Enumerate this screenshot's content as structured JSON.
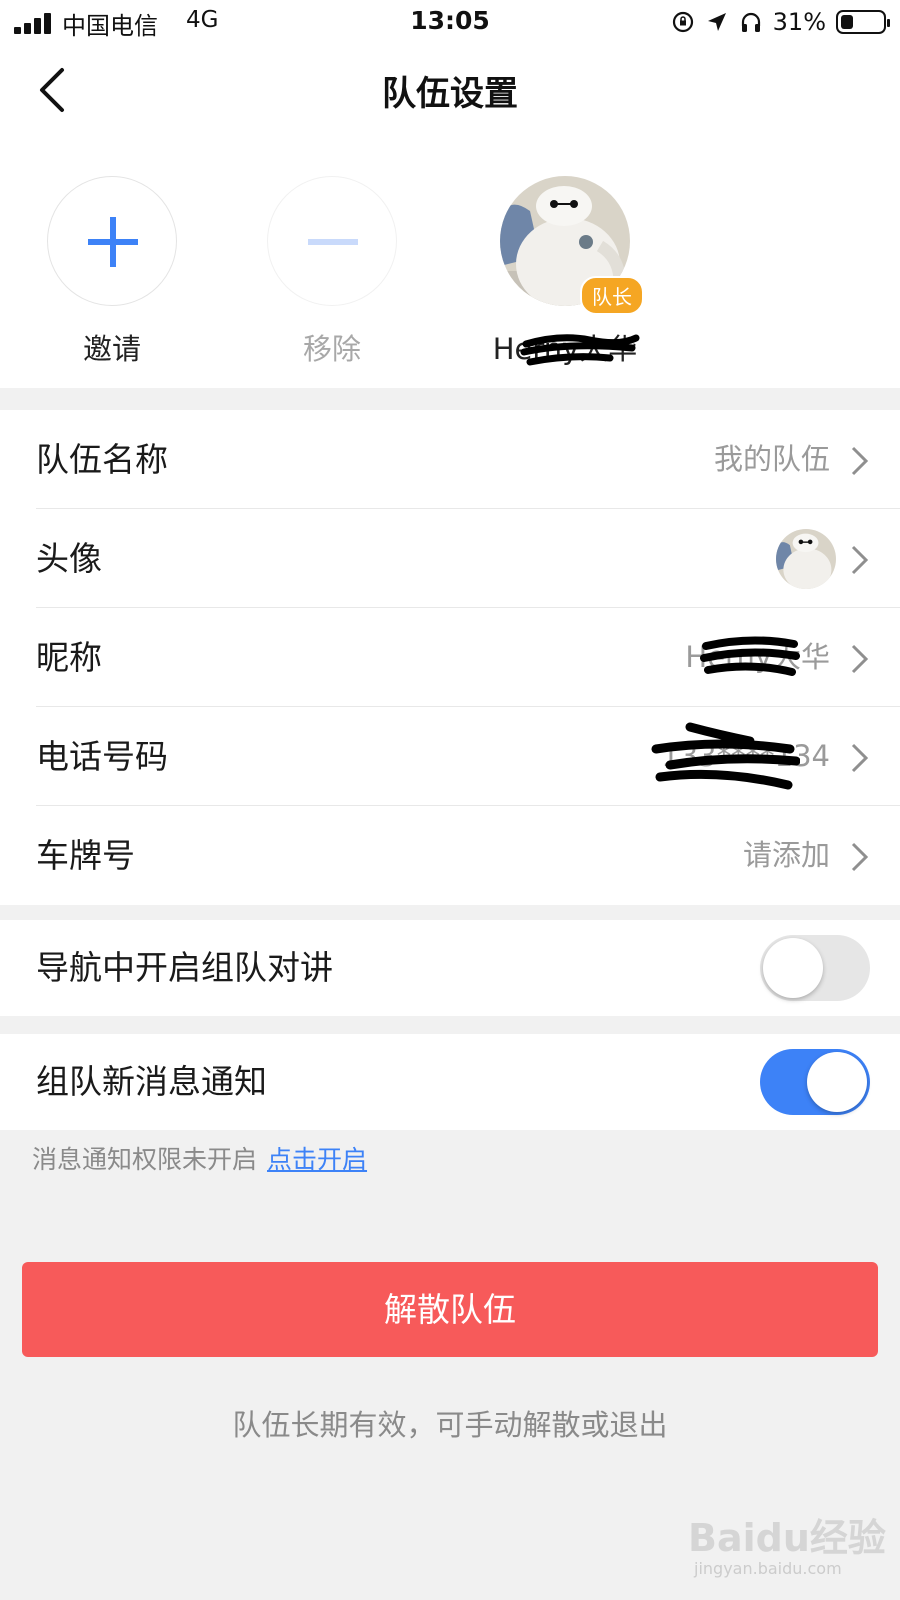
{
  "status_bar": {
    "carrier": "中国电信",
    "network": "4G",
    "time": "13:05",
    "battery_percent": "31%",
    "battery_level": 0.31,
    "icons": [
      "signal-icon",
      "orientation-lock-icon",
      "location-icon",
      "headphones-icon",
      "battery-icon"
    ]
  },
  "nav": {
    "title": "队伍设置",
    "back_icon": "chevron-left-icon"
  },
  "members": {
    "invite_label": "邀请",
    "remove_label": "移除",
    "leader_name": "Herny大华",
    "leader_badge": "队长",
    "accent_color": "#3d82f7"
  },
  "settings": {
    "team_name": {
      "label": "队伍名称",
      "value": "我的队伍"
    },
    "avatar": {
      "label": "头像"
    },
    "nickname": {
      "label": "昵称",
      "value": "Herny大华"
    },
    "phone": {
      "label": "电话号码",
      "value": "133****134"
    },
    "plate": {
      "label": "车牌号",
      "value": "请添加"
    }
  },
  "toggles": {
    "intercom": {
      "label": "导航中开启组队对讲",
      "on": false
    },
    "notify": {
      "label": "组队新消息通知",
      "on": true
    }
  },
  "notice": {
    "text": "消息通知权限未开启",
    "link": "点击开启"
  },
  "actions": {
    "disband_label": "解散队伍",
    "disband_color": "#f75a5a",
    "footer_note": "队伍长期有效，可手动解散或退出"
  },
  "watermark": {
    "brand": "Baidu经验",
    "url": "jingyan.baidu.com"
  }
}
